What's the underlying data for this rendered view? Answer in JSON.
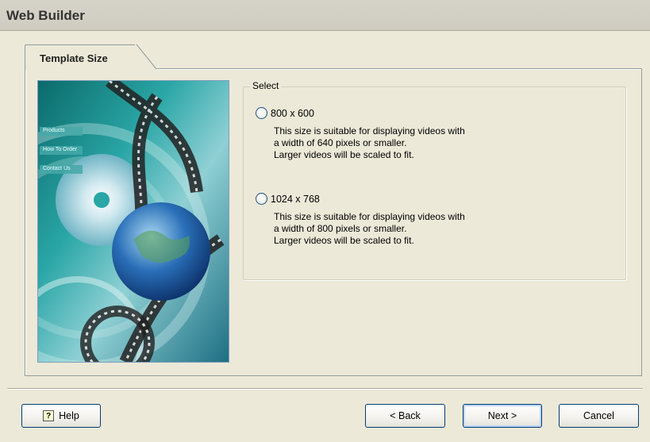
{
  "window": {
    "title": "Web Builder"
  },
  "tab": {
    "label": "Template Size"
  },
  "group": {
    "legend": "Select",
    "options": [
      {
        "label": "800 x 600",
        "description": [
          "This size is suitable for displaying videos with",
          "a width of 640 pixels or smaller.",
          "Larger videos will be scaled to fit."
        ],
        "selected": false
      },
      {
        "label": "1024 x 768",
        "description": [
          "This size is suitable for displaying videos with",
          "a width of 800 pixels or smaller.",
          "Larger videos will be scaled to fit."
        ],
        "selected": false
      }
    ]
  },
  "image": {
    "menu_items": [
      "Products",
      "How To Order",
      "Contact Us"
    ]
  },
  "buttons": {
    "help": "Help",
    "back": "< Back",
    "next": "Next >",
    "cancel": "Cancel"
  },
  "colors": {
    "background": "#ece9d8",
    "button_border": "#003c74",
    "radio_border": "#1c5180"
  }
}
